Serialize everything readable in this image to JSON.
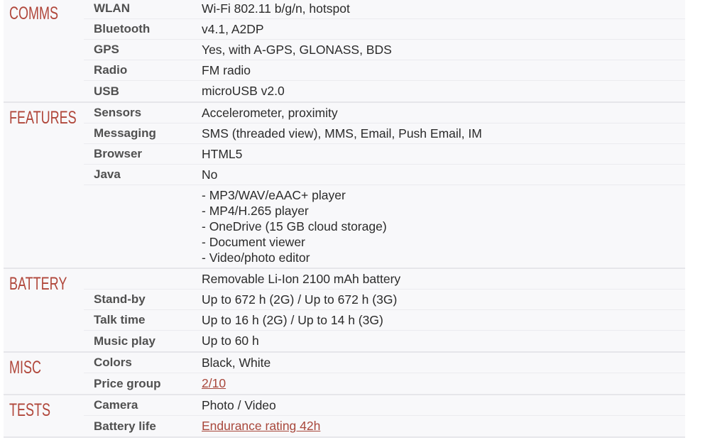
{
  "colors": {
    "section_title": "#b0463a",
    "link": "#a8473b",
    "background": "#f8f8fa"
  },
  "sections": [
    {
      "title": "COMMS",
      "rows": [
        {
          "label": "WLAN",
          "value": "Wi-Fi 802.11 b/g/n, hotspot"
        },
        {
          "label": "Bluetooth",
          "value": "v4.1, A2DP"
        },
        {
          "label": "GPS",
          "value": "Yes, with A-GPS, GLONASS, BDS"
        },
        {
          "label": "Radio",
          "value": "FM radio"
        },
        {
          "label": "USB",
          "value": "microUSB v2.0"
        }
      ]
    },
    {
      "title": "FEATURES",
      "rows": [
        {
          "label": "Sensors",
          "value": "Accelerometer, proximity"
        },
        {
          "label": "Messaging",
          "value": "SMS (threaded view), MMS, Email, Push Email, IM"
        },
        {
          "label": "Browser",
          "value": "HTML5"
        },
        {
          "label": "Java",
          "value": "No"
        },
        {
          "label": "",
          "lines": [
            "- MP3/WAV/eAAC+ player",
            "- MP4/H.265 player",
            "- OneDrive (15 GB cloud storage)",
            "- Document viewer",
            "- Video/photo editor"
          ]
        }
      ]
    },
    {
      "title": "BATTERY",
      "rows": [
        {
          "label": "",
          "value": "Removable Li-Ion 2100 mAh battery"
        },
        {
          "label": "Stand-by",
          "value": "Up to 672 h (2G) / Up to 672 h (3G)"
        },
        {
          "label": "Talk time",
          "value": "Up to 16 h (2G) / Up to 14 h (3G)"
        },
        {
          "label": "Music play",
          "value": "Up to 60 h"
        }
      ]
    },
    {
      "title": "MISC",
      "rows": [
        {
          "label": "Colors",
          "value": "Black, White"
        },
        {
          "label": "Price group",
          "value": "2/10",
          "link": true
        }
      ]
    },
    {
      "title": "TESTS",
      "rows": [
        {
          "label": "Camera",
          "value": "Photo / Video"
        },
        {
          "label": "Battery life",
          "value": "Endurance rating 42h",
          "link": true
        }
      ]
    }
  ]
}
